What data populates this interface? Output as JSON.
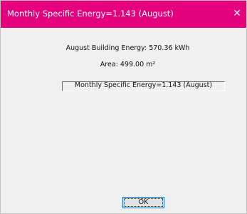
{
  "window": {
    "title": "Monthly Specific Energy=1.143 (August)",
    "close_glyph": "✕"
  },
  "content": {
    "energy_text": "August Building Energy: 570.36 kWh",
    "area_text": "Area: 499.00 m²",
    "result_text": "Monthly Specific Energy=1.143 (August)"
  },
  "buttons": {
    "ok_label": "OK"
  },
  "colors": {
    "titlebar": "#e5007e",
    "dialog_background": "#f0f0f0",
    "ok_button_border": "#0078d7"
  }
}
